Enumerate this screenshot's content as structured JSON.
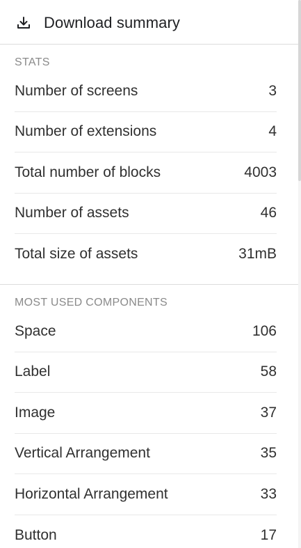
{
  "download": {
    "label": "Download summary",
    "icon": "download-icon"
  },
  "stats": {
    "title": "STATS",
    "items": [
      {
        "label": "Number of screens",
        "value": "3"
      },
      {
        "label": "Number of extensions",
        "value": "4"
      },
      {
        "label": "Total number of blocks",
        "value": "4003"
      },
      {
        "label": "Number of assets",
        "value": "46"
      },
      {
        "label": "Total size of assets",
        "value": "31mB"
      }
    ]
  },
  "components": {
    "title": "MOST USED COMPONENTS",
    "items": [
      {
        "label": "Space",
        "value": "106"
      },
      {
        "label": "Label",
        "value": "58"
      },
      {
        "label": "Image",
        "value": "37"
      },
      {
        "label": "Vertical Arrangement",
        "value": "35"
      },
      {
        "label": "Horizontal Arrangement",
        "value": "33"
      },
      {
        "label": "Button",
        "value": "17"
      }
    ]
  }
}
